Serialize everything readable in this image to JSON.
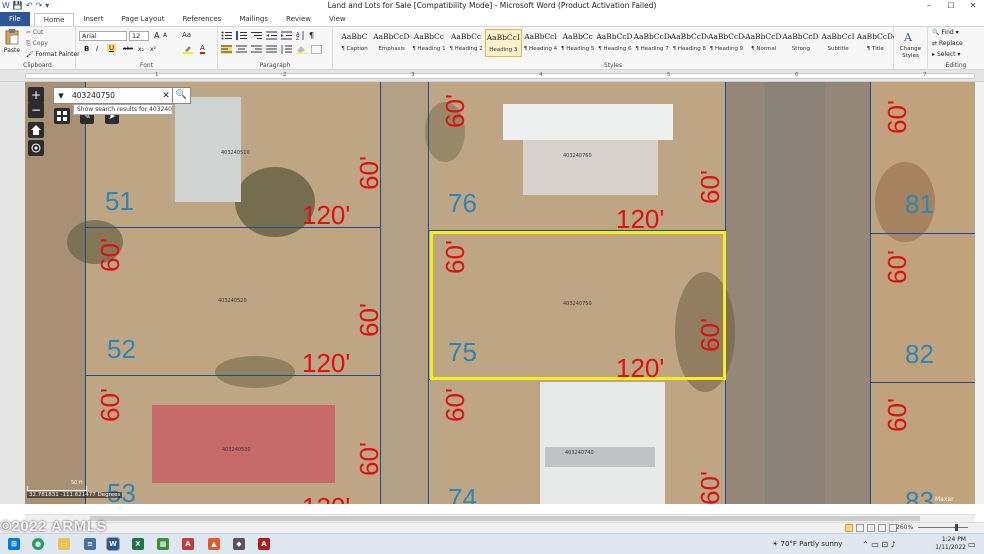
{
  "window": {
    "title": "Land and Lots for Sale [Compatibility Mode] - Microsoft Word (Product Activation Failed)",
    "controls": [
      "–",
      "☐",
      "✕"
    ],
    "qat": [
      "W",
      "💾",
      "↶",
      "↷",
      "▾"
    ]
  },
  "tabs": [
    {
      "label": "File"
    },
    {
      "label": "Home"
    },
    {
      "label": "Insert"
    },
    {
      "label": "Page Layout"
    },
    {
      "label": "References"
    },
    {
      "label": "Mailings"
    },
    {
      "label": "Review"
    },
    {
      "label": "View"
    }
  ],
  "ribbon": {
    "clipboard": {
      "label": "Clipboard",
      "paste": "Paste",
      "cut": "Cut",
      "copy": "Copy",
      "format_painter": "Format Painter"
    },
    "font": {
      "label": "Font",
      "family": "Arial",
      "size": "12",
      "buttons": [
        "B",
        "I",
        "U",
        "abc",
        "x₂",
        "x²",
        "A",
        "A",
        "Aa",
        "A"
      ]
    },
    "paragraph": {
      "label": "Paragraph",
      "pilcrow": "¶"
    },
    "styles": {
      "label": "Styles",
      "items": [
        {
          "preview": "AaBbC",
          "name": "¶ Caption"
        },
        {
          "preview": "AaBbCcDc",
          "name": "Emphasis"
        },
        {
          "preview": "AaBbCc",
          "name": "¶ Heading 1"
        },
        {
          "preview": "AaBbCc",
          "name": "¶ Heading 2"
        },
        {
          "preview": "AaBbCcI",
          "name": "Heading 3"
        },
        {
          "preview": "AaBbCcl",
          "name": "¶ Heading 4"
        },
        {
          "preview": "AaBbCc",
          "name": "¶ Heading 5"
        },
        {
          "preview": "AaBbCcDc",
          "name": "¶ Heading 6"
        },
        {
          "preview": "AaBbCcDc",
          "name": "¶ Heading 7"
        },
        {
          "preview": "AaBbCcDc",
          "name": "¶ Heading 8"
        },
        {
          "preview": "AaBbCcDc",
          "name": "¶ Heading 9"
        },
        {
          "preview": "AaBbCcDc",
          "name": "¶ Normal"
        },
        {
          "preview": "AaBbCcDd",
          "name": "Strong"
        },
        {
          "preview": "AaBbCcI",
          "name": "Subtitle"
        },
        {
          "preview": "AaBbCcDdI",
          "name": "¶ Title"
        }
      ],
      "selected_index": 4,
      "change_styles": "Change Styles"
    },
    "editing": {
      "label": "Editing",
      "find": "Find",
      "replace": "Replace",
      "select": "Select"
    }
  },
  "ruler": {
    "marks": [
      "1",
      "2",
      "3",
      "4",
      "5",
      "6",
      "7"
    ]
  },
  "map": {
    "search_value": "403240750",
    "suggestion": "Show search results for 403240750",
    "zoom_in": "+",
    "zoom_out": "−",
    "lots": [
      "51",
      "52",
      "53",
      "76",
      "75",
      "74",
      "81",
      "82",
      "83"
    ],
    "dimensions": {
      "width_label": "120'",
      "depth_label": "60'"
    },
    "parcel_ids": [
      "403240510",
      "403240520",
      "403240530",
      "403240760",
      "403240750",
      "403240740"
    ],
    "coordinates": "32.781831 -111.621477 Degrees",
    "scale": "50 ft",
    "attribution": "Maxar"
  },
  "statusbar": {
    "zoom": "260%"
  },
  "taskbar": {
    "weather": "70°F  Partly sunny",
    "time": "1:24 PM",
    "date": "1/11/2022"
  },
  "watermark": "©2022 ARMLS",
  "colors": {
    "accent": "#2b579a",
    "highlight": "#f6ee21",
    "dimension_text": "#e01010",
    "lot_text": "#2d86b5"
  }
}
